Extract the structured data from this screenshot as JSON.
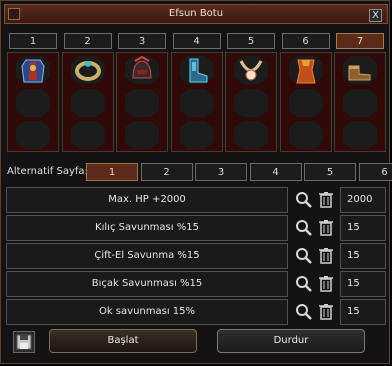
{
  "window": {
    "title": "Efsun Botu",
    "close_label": "X"
  },
  "slots": [
    {
      "number": "1",
      "item": "armor-icon",
      "active": true
    },
    {
      "number": "2",
      "item": "bracelet-icon",
      "active": false
    },
    {
      "number": "3",
      "item": "helmet-icon",
      "active": false
    },
    {
      "number": "4",
      "item": "boots-blue-icon",
      "active": false
    },
    {
      "number": "5",
      "item": "necklace-icon",
      "active": false
    },
    {
      "number": "6",
      "item": "costume-icon",
      "active": false
    },
    {
      "number": "7",
      "item": "shoes-icon",
      "active": false
    }
  ],
  "alt_page": {
    "label": "Alternatif Sayfa:",
    "pages": [
      "1",
      "2",
      "3",
      "4",
      "5",
      "6"
    ],
    "selected": "1"
  },
  "bonuses": [
    {
      "name": "Max. HP +2000",
      "value": "2000"
    },
    {
      "name": "Kılıç Savunması %15",
      "value": "15"
    },
    {
      "name": "Çift-El Savunma %15",
      "value": "15"
    },
    {
      "name": "Bıçak Savunması %15",
      "value": "15"
    },
    {
      "name": "Ok savunması 15%",
      "value": "15"
    }
  ],
  "actions": {
    "start": "Başlat",
    "stop": "Durdur"
  },
  "colors": {
    "accent": "#5c2c18",
    "slot_bg": "#300909",
    "panel_bg": "#141212"
  }
}
